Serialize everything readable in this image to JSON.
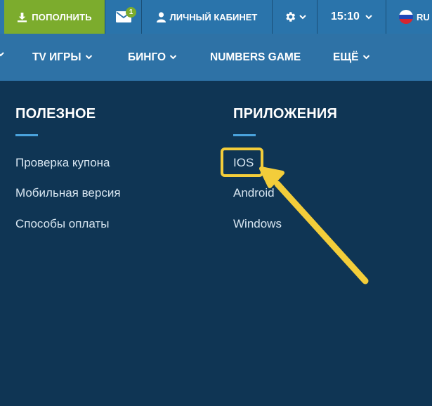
{
  "topbar": {
    "deposit_label": "ПОПОЛНИТЬ",
    "mail_badge": "1",
    "cabinet_label": "ЛИЧНЫЙ КАБИНЕТ",
    "time": "15:10",
    "lang": "RU"
  },
  "nav": {
    "items": [
      {
        "label": "TV ИГРЫ"
      },
      {
        "label": "БИНГО"
      },
      {
        "label": "NUMBERS GAME"
      },
      {
        "label": "ЕЩЁ"
      }
    ]
  },
  "menu": {
    "useful": {
      "title": "ПОЛЕЗНОЕ",
      "links": [
        "Проверка купона",
        "Мобильная версия",
        "Способы оплаты"
      ]
    },
    "apps": {
      "title": "ПРИЛОЖЕНИЯ",
      "links": [
        "IOS",
        "Android",
        "Windows"
      ]
    }
  },
  "colors": {
    "deposit_green": "#7cac2d",
    "topbar_blue": "#2a74ab",
    "nav_blue": "#2e72a6",
    "panel_bg": "#0f3554",
    "accent_underline": "#4aa3dd",
    "annotation_yellow": "#f3cd3a"
  },
  "icons": [
    "download-icon",
    "mail-icon",
    "user-icon",
    "gear-icon",
    "chevron-down-icon",
    "russia-flag-icon"
  ]
}
